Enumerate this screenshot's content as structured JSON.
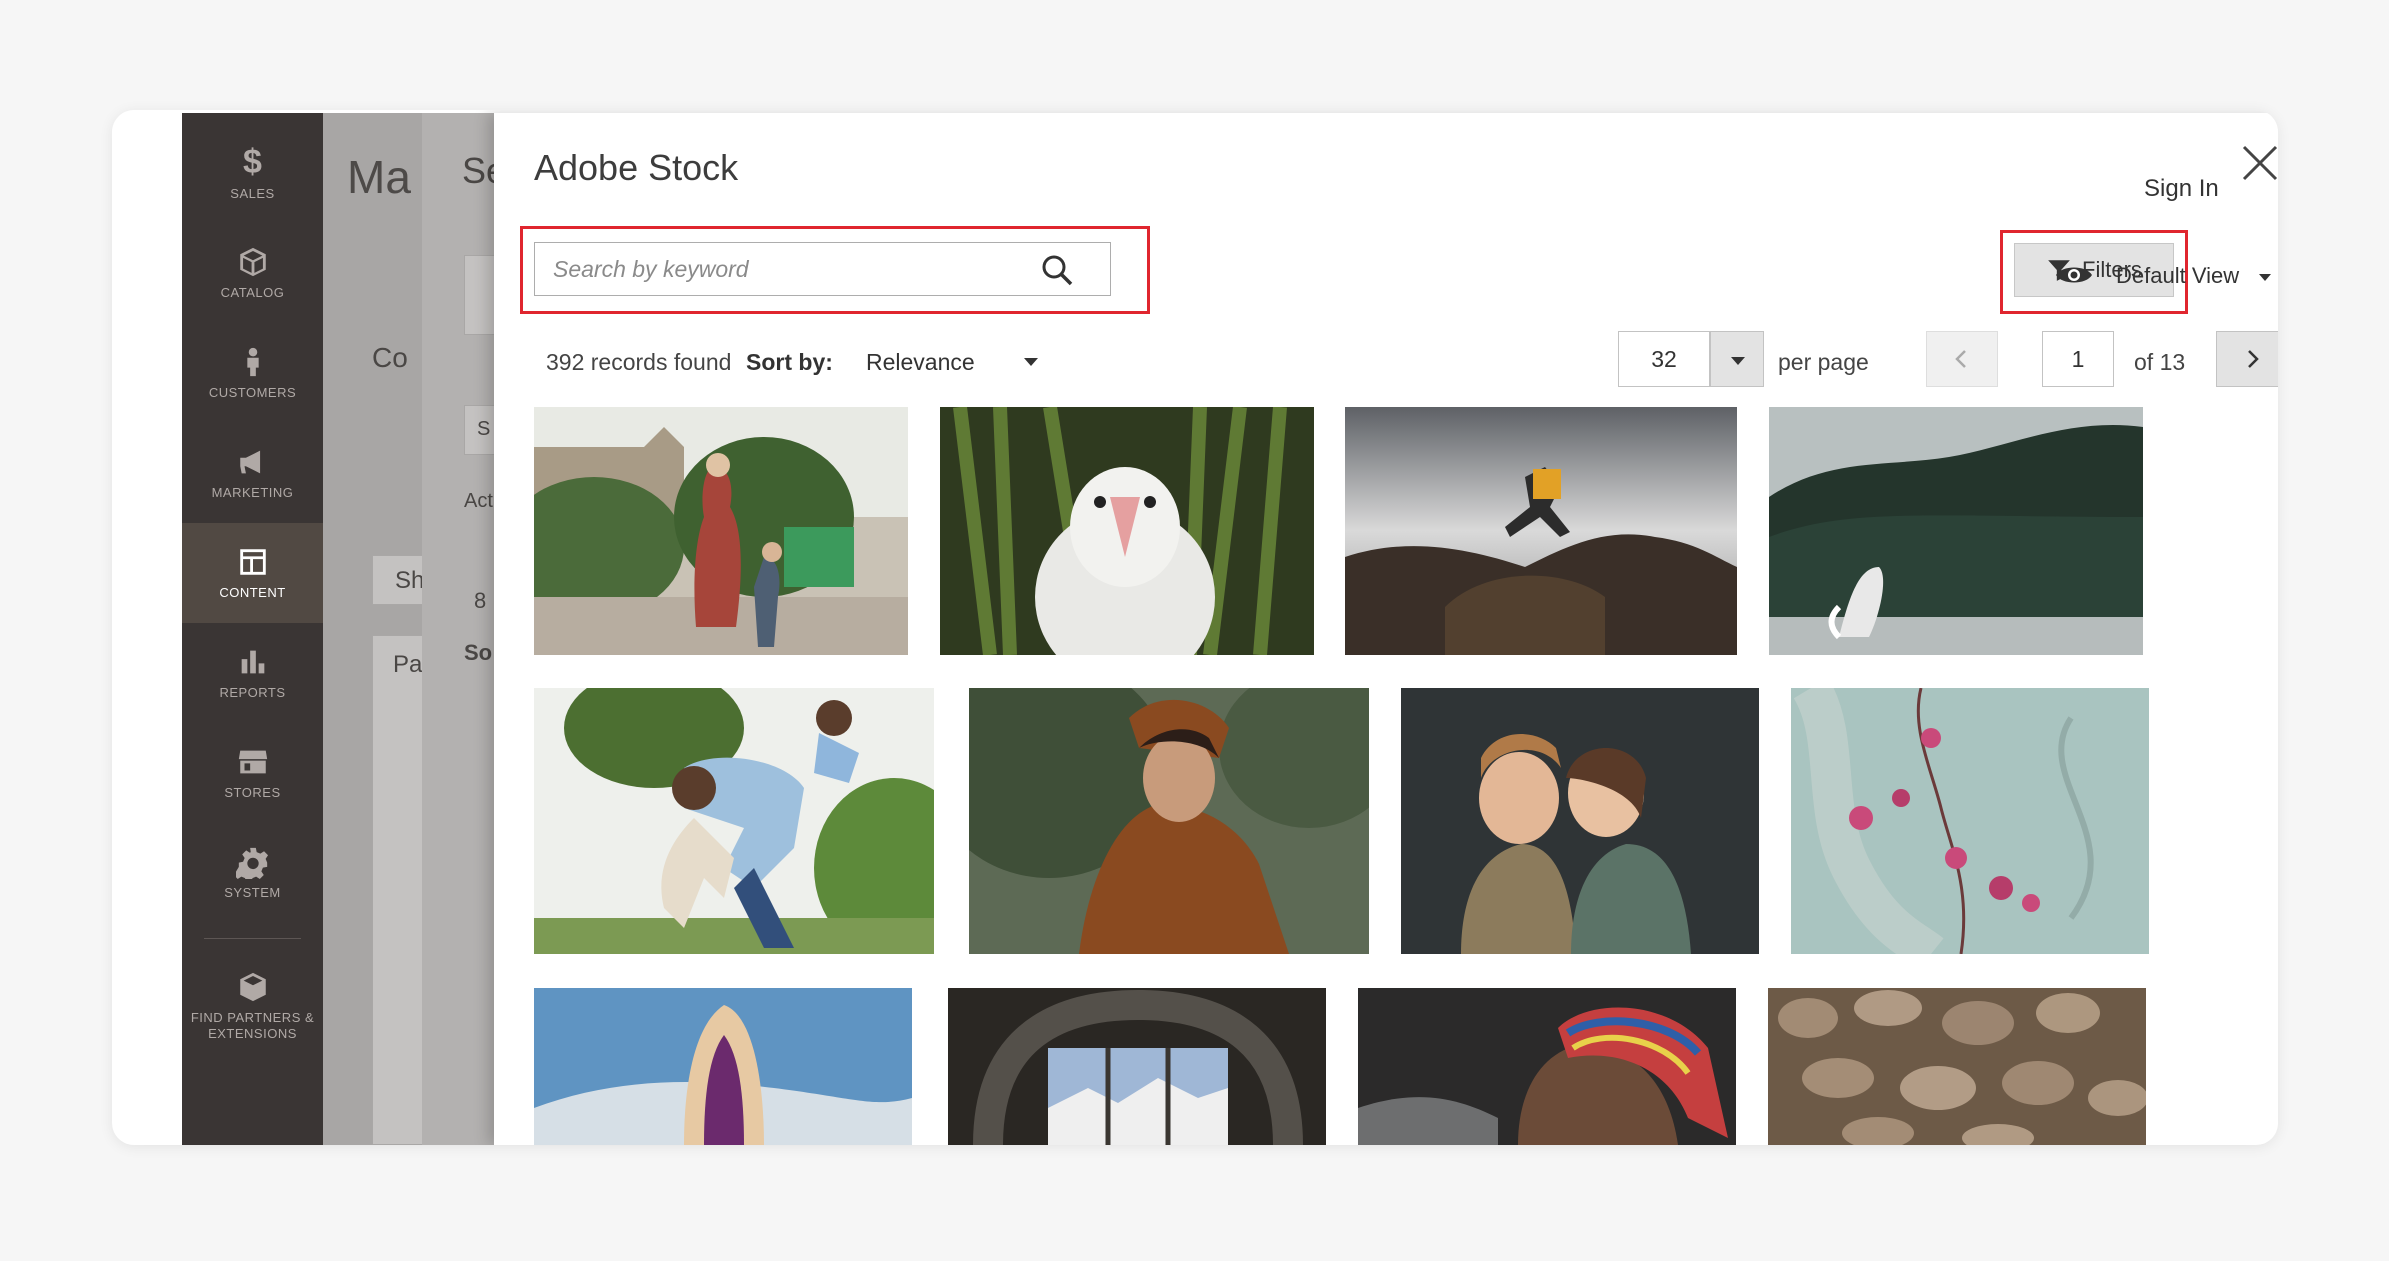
{
  "sidebar": {
    "items": [
      {
        "label": "SALES",
        "icon": "dollar-icon",
        "glyph": "$"
      },
      {
        "label": "CATALOG",
        "icon": "cube-icon"
      },
      {
        "label": "CUSTOMERS",
        "icon": "person-icon"
      },
      {
        "label": "MARKETING",
        "icon": "megaphone-icon"
      },
      {
        "label": "CONTENT",
        "icon": "layout-icon"
      },
      {
        "label": "REPORTS",
        "icon": "bar-chart-icon"
      },
      {
        "label": "STORES",
        "icon": "storefront-icon"
      },
      {
        "label": "SYSTEM",
        "icon": "gear-icon"
      },
      {
        "label": "FIND PARTNERS & EXTENSIONS",
        "icon": "box-icon"
      }
    ],
    "active": "CONTENT"
  },
  "background": {
    "title": "Ma",
    "panel_title": "Se",
    "content_label": "Co",
    "action_label": "Act",
    "show_button": "Sh",
    "pa_label": "Pa",
    "count": "8",
    "sort_label": "So",
    "search_placeholder": "S"
  },
  "modal": {
    "title": "Adobe Stock",
    "sign_in": "Sign In",
    "search": {
      "placeholder": "Search by keyword"
    },
    "filters_label": "Filters",
    "view_label": "Default View",
    "records_found": "392 records found",
    "sort_label": "Sort by:",
    "sort_value": "Relevance",
    "per_page_value": "32",
    "per_page_label": "per page",
    "current_page": "1",
    "total_pages_label": "of 13"
  },
  "colors": {
    "highlight": "#e0262f",
    "sidebar": "#3a3534",
    "sidebar_active": "#514943"
  },
  "thumbnails": [
    {
      "subject": "mother and child in garden",
      "row": 1
    },
    {
      "subject": "white baby bird in grass",
      "row": 1
    },
    {
      "subject": "person jumping over rocks",
      "row": 1
    },
    {
      "subject": "whale breaching near forest",
      "row": 1
    },
    {
      "subject": "father lifting daughter",
      "row": 2
    },
    {
      "subject": "woman in rain jacket",
      "row": 2
    },
    {
      "subject": "two children hugging",
      "row": 2
    },
    {
      "subject": "pink flowers on teal wall",
      "row": 2
    },
    {
      "subject": "woman in shawl at mountains",
      "row": 3
    },
    {
      "subject": "tunnel window to mountains",
      "row": 3
    },
    {
      "subject": "man with striped headscarf",
      "row": 3
    },
    {
      "subject": "mushrooms texture",
      "row": 3
    }
  ]
}
